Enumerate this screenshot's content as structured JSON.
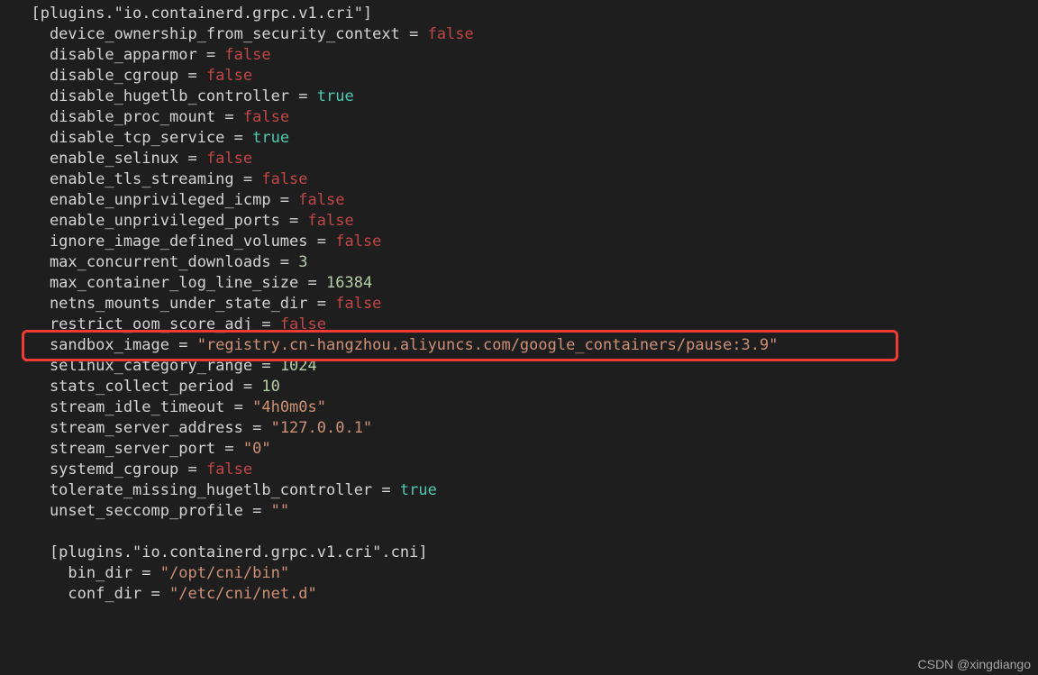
{
  "section_header": "[plugins.\"io.containerd.grpc.v1.cri\"]",
  "settings": [
    {
      "key": "device_ownership_from_security_context",
      "val": "false",
      "type": "bool"
    },
    {
      "key": "disable_apparmor",
      "val": "false",
      "type": "bool"
    },
    {
      "key": "disable_cgroup",
      "val": "false",
      "type": "bool"
    },
    {
      "key": "disable_hugetlb_controller",
      "val": "true",
      "type": "bool"
    },
    {
      "key": "disable_proc_mount",
      "val": "false",
      "type": "bool"
    },
    {
      "key": "disable_tcp_service",
      "val": "true",
      "type": "bool"
    },
    {
      "key": "enable_selinux",
      "val": "false",
      "type": "bool"
    },
    {
      "key": "enable_tls_streaming",
      "val": "false",
      "type": "bool"
    },
    {
      "key": "enable_unprivileged_icmp",
      "val": "false",
      "type": "bool"
    },
    {
      "key": "enable_unprivileged_ports",
      "val": "false",
      "type": "bool"
    },
    {
      "key": "ignore_image_defined_volumes",
      "val": "false",
      "type": "bool"
    },
    {
      "key": "max_concurrent_downloads",
      "val": "3",
      "type": "num"
    },
    {
      "key": "max_container_log_line_size",
      "val": "16384",
      "type": "num"
    },
    {
      "key": "netns_mounts_under_state_dir",
      "val": "false",
      "type": "bool"
    },
    {
      "key": "restrict_oom_score_adj",
      "val": "false",
      "type": "bool"
    },
    {
      "key": "sandbox_image",
      "val": "\"registry.cn-hangzhou.aliyuncs.com/google_containers/pause:3.9\"",
      "type": "str",
      "highlight": true
    },
    {
      "key": "selinux_category_range",
      "val": "1024",
      "type": "num"
    },
    {
      "key": "stats_collect_period",
      "val": "10",
      "type": "num"
    },
    {
      "key": "stream_idle_timeout",
      "val": "\"4h0m0s\"",
      "type": "str"
    },
    {
      "key": "stream_server_address",
      "val": "\"127.0.0.1\"",
      "type": "str"
    },
    {
      "key": "stream_server_port",
      "val": "\"0\"",
      "type": "str"
    },
    {
      "key": "systemd_cgroup",
      "val": "false",
      "type": "bool"
    },
    {
      "key": "tolerate_missing_hugetlb_controller",
      "val": "true",
      "type": "bool"
    },
    {
      "key": "unset_seccomp_profile",
      "val": "\"\"",
      "type": "str"
    }
  ],
  "sub_section_header": "[plugins.\"io.containerd.grpc.v1.cri\".cni]",
  "sub_settings": [
    {
      "key": "bin_dir",
      "val": "\"/opt/cni/bin\"",
      "type": "str"
    },
    {
      "key": "conf_dir",
      "val": "\"/etc/cni/net.d\"",
      "type": "str"
    }
  ],
  "watermark": "CSDN @xingdiango"
}
